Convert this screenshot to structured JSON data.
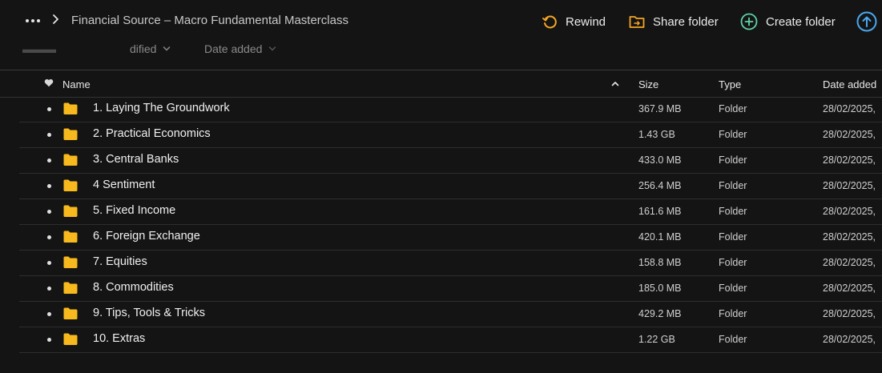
{
  "breadcrumb": {
    "title": "Financial Source – Macro Fundamental Masterclass"
  },
  "actions": {
    "rewind": "Rewind",
    "share_folder": "Share folder",
    "create_folder": "Create folder"
  },
  "sort": {
    "modified_label": "dified",
    "date_added_label": "Date added"
  },
  "table": {
    "headers": {
      "name": "Name",
      "size": "Size",
      "type": "Type",
      "date_added": "Date added"
    },
    "rows": [
      {
        "name": "1. Laying The Groundwork",
        "size": "367.9 MB",
        "type": "Folder",
        "date": "28/02/2025,"
      },
      {
        "name": "2. Practical Economics",
        "size": "1.43 GB",
        "type": "Folder",
        "date": "28/02/2025,"
      },
      {
        "name": "3. Central Banks",
        "size": "433.0 MB",
        "type": "Folder",
        "date": "28/02/2025,"
      },
      {
        "name": "4 Sentiment",
        "size": "256.4 MB",
        "type": "Folder",
        "date": "28/02/2025,"
      },
      {
        "name": "5. Fixed Income",
        "size": "161.6 MB",
        "type": "Folder",
        "date": "28/02/2025,"
      },
      {
        "name": "6. Foreign Exchange",
        "size": "420.1 MB",
        "type": "Folder",
        "date": "28/02/2025,"
      },
      {
        "name": "7. Equities",
        "size": "158.8 MB",
        "type": "Folder",
        "date": "28/02/2025,"
      },
      {
        "name": "8. Commodities",
        "size": "185.0 MB",
        "type": "Folder",
        "date": "28/02/2025,"
      },
      {
        "name": "9. Tips, Tools & Tricks",
        "size": "429.2 MB",
        "type": "Folder",
        "date": "28/02/2025,"
      },
      {
        "name": "10. Extras",
        "size": "1.22 GB",
        "type": "Folder",
        "date": "28/02/2025,"
      }
    ]
  },
  "icons": {
    "more": "more-horizontal-icon",
    "chevron": "chevron-right-icon",
    "rewind": "rewind-icon",
    "share": "shared-folder-icon",
    "create": "plus-circle-icon",
    "upload": "upload-arrow-icon",
    "heart": "heart-icon",
    "sort_asc": "caret-up-icon",
    "folder": "folder-icon"
  },
  "colors": {
    "background": "#141414",
    "accent_orange": "#f5a623",
    "accent_green": "#5fd3a8",
    "accent_blue": "#4aa8f0",
    "folder_yellow": "#f7b91d"
  }
}
